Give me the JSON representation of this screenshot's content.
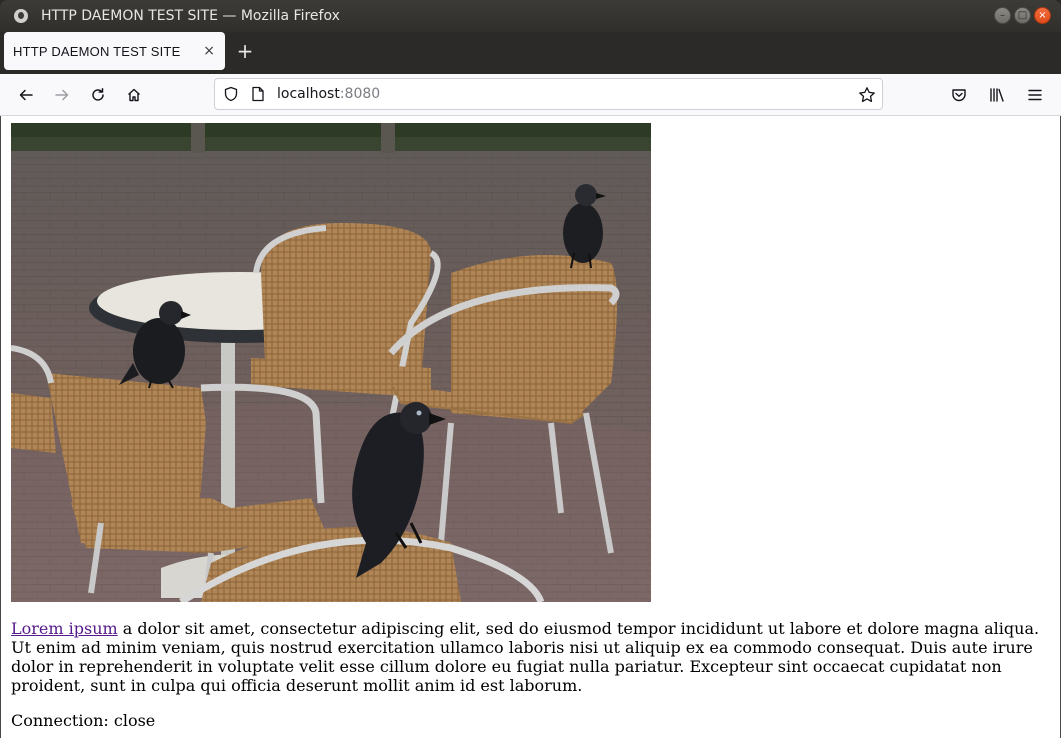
{
  "window": {
    "title": "HTTP DAEMON TEST SITE — Mozilla Firefox",
    "controls": {
      "minimize": "–",
      "maximize": "□",
      "close": "×"
    }
  },
  "tabs": [
    {
      "label": "HTTP DAEMON TEST SITE",
      "close": "×",
      "active": true
    }
  ],
  "newtab_label": "+",
  "toolbar": {
    "url_host": "localhost",
    "url_port": ":8080",
    "icons": [
      "back-icon",
      "forward-icon",
      "reload-icon",
      "home-icon",
      "shield-icon",
      "page-icon",
      "bookmark-star-icon",
      "pocket-icon",
      "library-icon",
      "menu-icon"
    ]
  },
  "page": {
    "image_alt_icon": "jackdaws-on-cafe-chairs-photo",
    "link_text": "Lorem ipsum",
    "paragraph_rest": " a dolor sit amet, consectetur adipiscing elit, sed do eiusmod tempor incididunt ut labore et dolore magna aliqua. Ut enim ad minim veniam, quis nostrud exercitation ullamco laboris nisi ut aliquip ex ea commodo consequat. Duis aute irure dolor in reprehenderit in voluptate velit esse cillum dolore eu fugiat nulla pariatur. Excepteur sint occaecat cupidatat non proident, sunt in culpa qui officia deserunt mollit anim id est laborum.",
    "connection_line": "Connection: close"
  },
  "colors": {
    "titlebar": "#3c3b37",
    "tab_active": "#f9f9fb",
    "link_visited": "#551a8b",
    "close_button": "#e24b1a"
  }
}
